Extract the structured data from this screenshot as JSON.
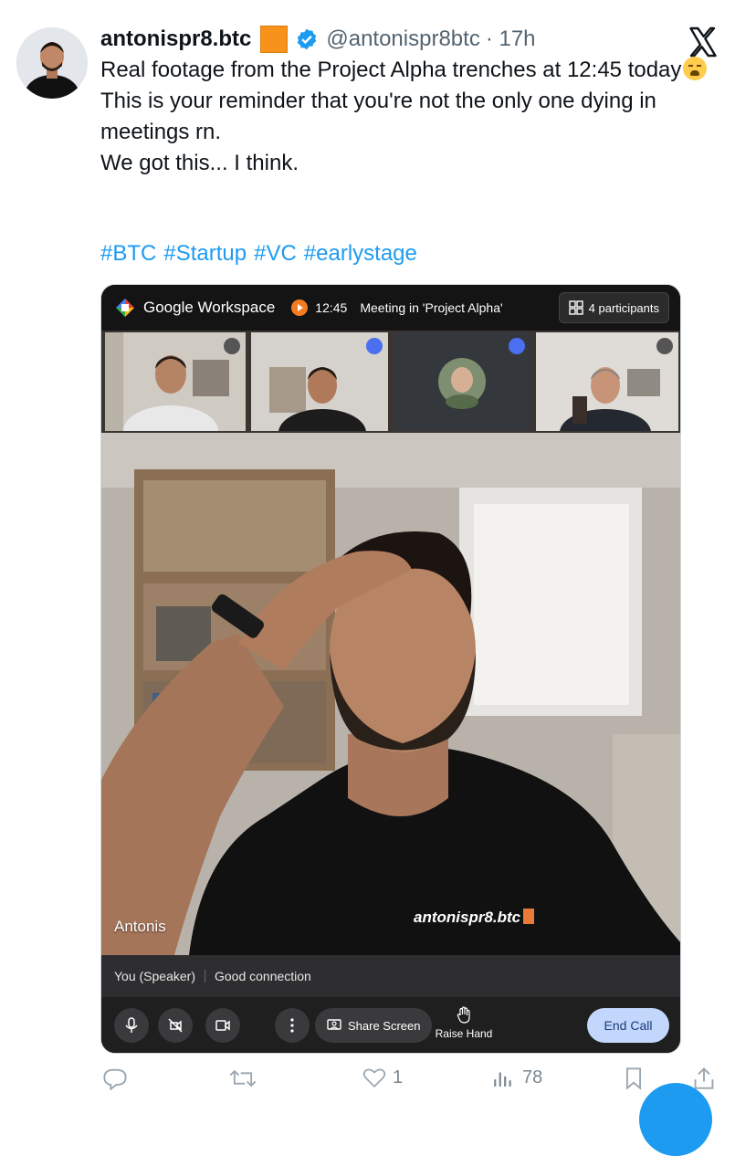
{
  "tweet": {
    "display_name": "antonispr8.btc",
    "handle": "@antonispr8btc",
    "time": "· 17h",
    "lines": [
      "Real footage from the Project Alpha trenches at 12:45 today",
      "This is your reminder that you're not the only one dying in meetings rn.",
      "We got this... I think."
    ],
    "hashtags": [
      "#BTC",
      "#Startup",
      "#VC",
      "#earlystage"
    ]
  },
  "meet": {
    "brand_bold": "Google",
    "brand_rest": " Workspace",
    "time": "12:45",
    "title": "Meeting in 'Project Alpha'",
    "participants": "4 participants",
    "speaker_name": "Antonis",
    "shirt_text": "antonispr8.btc",
    "status_you": "You (Speaker)",
    "status_conn": "Good connection",
    "share_label": "Share Screen",
    "raise_label": "Raise Hand",
    "end_label": "End Call"
  },
  "actions": {
    "likes": "1",
    "views": "78"
  },
  "icons": [
    "x-logo-icon",
    "verified-badge-icon",
    "mic-icon",
    "camera-off-icon",
    "video-icon",
    "more-icon",
    "share-screen-icon",
    "raise-hand-icon",
    "reply-icon",
    "retweet-icon",
    "like-icon",
    "views-icon",
    "bookmark-icon",
    "share-icon"
  ],
  "colors": {
    "link": "#1d9bf0",
    "accent_orange": "#f7931a",
    "end_call": "#c2d7fb"
  }
}
